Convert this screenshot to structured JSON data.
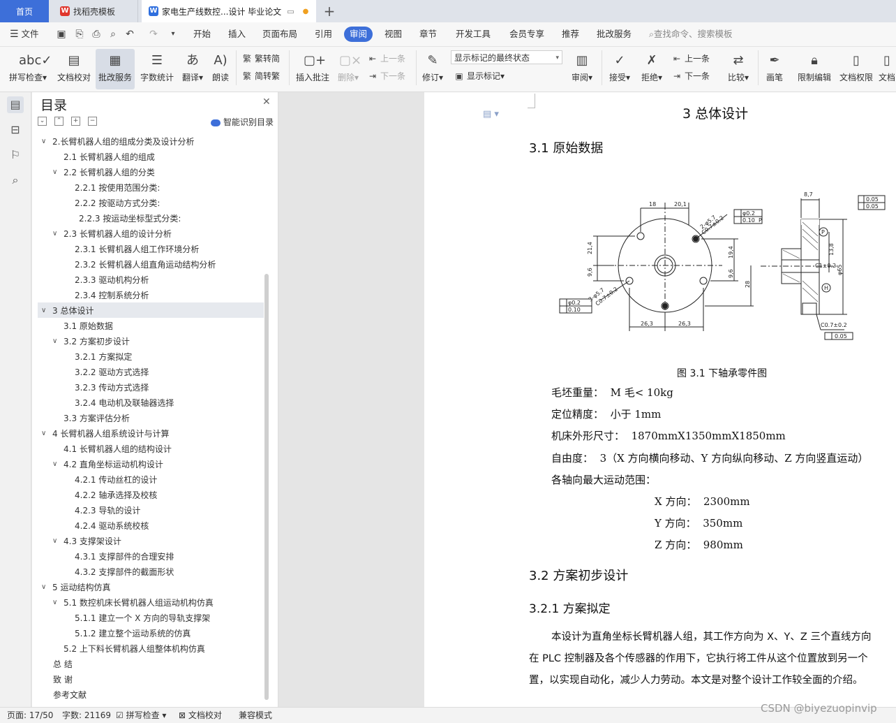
{
  "tabs": {
    "home": "首页",
    "template": "找稻壳模板",
    "document": "家电生产线数控...设计 毕业论文",
    "template_icon": "wps-docer-icon",
    "document_icon": "wps-writer-icon",
    "add": "+"
  },
  "menu": {
    "file": "文件",
    "items": [
      "开始",
      "插入",
      "页面布局",
      "引用",
      "审阅",
      "视图",
      "章节",
      "开发工具",
      "会员专享",
      "推荐",
      "批改服务"
    ],
    "search_placeholder": "查找命令、搜索模板"
  },
  "ribbon": {
    "spellcheck": "拼写检查",
    "doc_check": "文档校对",
    "revise_service": "批改服务",
    "word_count": "字数统计",
    "translate": "翻译",
    "read_aloud": "朗读",
    "trad_to_simp": "繁转简",
    "simp_to_trad": "简转繁",
    "insert_comment": "插入批注",
    "delete": "删除",
    "prev": "上一条",
    "next": "下一条",
    "track_changes": "修订",
    "markup_state": "显示标记的最终状态",
    "show_markup": "显示标记",
    "review_pane": "审阅",
    "accept": "接受",
    "reject": "拒绝",
    "prev2": "上一条",
    "next2": "下一条",
    "compare": "比较",
    "pen": "画笔",
    "restrict_edit": "限制编辑",
    "doc_permission": "文档权限",
    "doc_more": "文档"
  },
  "toc": {
    "title": "目录",
    "smart": "智能识别目录",
    "items": [
      {
        "text": "2.长臂机器人组的组成分类及设计分析",
        "level": 1,
        "arrow": true
      },
      {
        "text": "2.1  长臂机器人组的组成",
        "level": 2,
        "arrow": false
      },
      {
        "text": "2.2  长臂机器人组的分类",
        "level": 2,
        "arrow": true
      },
      {
        "text": "2.2.1  按使用范围分类:",
        "level": 3,
        "arrow": false
      },
      {
        "text": "2.2.2 按驱动方式分类:",
        "level": 3,
        "arrow": false
      },
      {
        "text": "2.2.3 按运动坐标型式分类:",
        "level": 4,
        "arrow": false
      },
      {
        "text": "2.3  长臂机器人组的设计分析",
        "level": 2,
        "arrow": true
      },
      {
        "text": "2.3.1 长臂机器人组工作环境分析",
        "level": 3,
        "arrow": false
      },
      {
        "text": "2.3.2 长臂机器人组直角运动结构分析",
        "level": 3,
        "arrow": false
      },
      {
        "text": "2.3.3 驱动机构分析",
        "level": 3,
        "arrow": false
      },
      {
        "text": "2.3.4 控制系统分析",
        "level": 3,
        "arrow": false
      },
      {
        "text": "3  总体设计",
        "level": 1,
        "arrow": true
      },
      {
        "text": "3.1  原始数据",
        "level": 2,
        "arrow": false
      },
      {
        "text": "3.2  方案初步设计",
        "level": 2,
        "arrow": true
      },
      {
        "text": "3.2.1  方案拟定",
        "level": 3,
        "arrow": false
      },
      {
        "text": "3.2.2  驱动方式选择",
        "level": 3,
        "arrow": false
      },
      {
        "text": "3.2.3  传动方式选择",
        "level": 3,
        "arrow": false
      },
      {
        "text": "3.2.4  电动机及联轴器选择",
        "level": 3,
        "arrow": false
      },
      {
        "text": "3.3  方案评估分析",
        "level": 2,
        "arrow": false
      },
      {
        "text": "4  长臂机器人组系统设计与计算",
        "level": 1,
        "arrow": true
      },
      {
        "text": "4.1 长臂机器人组的结构设计",
        "level": 2,
        "arrow": false
      },
      {
        "text": "4.2 直角坐标运动机构设计",
        "level": 2,
        "arrow": true
      },
      {
        "text": "4.2.1 传动丝杠的设计",
        "level": 3,
        "arrow": false
      },
      {
        "text": "4.2.2 轴承选择及校核",
        "level": 3,
        "arrow": false
      },
      {
        "text": "4.2.3 导轨的设计",
        "level": 3,
        "arrow": false
      },
      {
        "text": "4.2.4  驱动系统校核",
        "level": 3,
        "arrow": false
      },
      {
        "text": "4.3  支撑架设计",
        "level": 2,
        "arrow": true
      },
      {
        "text": "4.3.1 支撑部件的合理安排",
        "level": 3,
        "arrow": false
      },
      {
        "text": "4.3.2 支撑部件的截面形状",
        "level": 3,
        "arrow": false
      },
      {
        "text": "5  运动结构仿真",
        "level": 1,
        "arrow": true
      },
      {
        "text": "5.1 数控机床长臂机器人组运动机构仿真",
        "level": 2,
        "arrow": true
      },
      {
        "text": "5.1.1 建立一个 X 方向的导轨支撑架",
        "level": 3,
        "arrow": false
      },
      {
        "text": "5.1.2 建立整个运动系统的仿真",
        "level": 3,
        "arrow": false
      },
      {
        "text": "5.2 上下料长臂机器人组整体机构仿真",
        "level": 2,
        "arrow": false
      },
      {
        "text": "总  结",
        "level": 0,
        "arrow": false
      },
      {
        "text": "致  谢",
        "level": 0,
        "arrow": false
      },
      {
        "text": "参考文献",
        "level": 0,
        "arrow": false
      }
    ]
  },
  "document": {
    "chapter_title": "3  总体设计",
    "section_title": "3.1  原始数据",
    "figure_caption": "图 3.1  下轴承零件图",
    "drawing_labels": {
      "d18": "18",
      "d20_1": "20,1",
      "d21_4": "21,4",
      "d9_6": "9,6",
      "d19_4": "19,4",
      "d9_6b": "9,6",
      "d28": "28",
      "d26_3a": "26,3",
      "d26_3b": "26,3",
      "hole_top": "2-φ5.7",
      "hole_bottom": "3-φ5.7",
      "ch_top": "C0.7±0.2",
      "ch_bot": "C0.7±0.2",
      "tol_top1": "φ0.2",
      "tol_top2": "0.10",
      "datum_p": "P",
      "tol_bot1": "φ0.2",
      "tol_bot2": "0.10",
      "d8_7": "8,7",
      "tol_r1": "0.05",
      "tol_r2": "0.05",
      "datum_h": "H",
      "d13_8": "13,8",
      "d65": "φ65",
      "c1": "C1±0.2",
      "c07": "C0.7±0.2",
      "tol_r3": "0.05"
    },
    "params": [
      {
        "label": "毛坯重量：",
        "value": "M 毛< 10kg"
      },
      {
        "label": "定位精度：",
        "value": "小于 1mm"
      },
      {
        "label": "机床外形尺寸：",
        "value": "1870mmX1350mmX1850mm"
      },
      {
        "label": "自由度：",
        "value": "3（X 方向横向移动、Y 方向纵向移动、Z 方向竖直运动）"
      }
    ],
    "axis_range_intro": "各轴向最大运动范围：",
    "axis_ranges": [
      {
        "label": "X 方向：",
        "value": "2300mm"
      },
      {
        "label": "Y 方向：",
        "value": "350mm"
      },
      {
        "label": "Z 方向：",
        "value": "980mm"
      }
    ],
    "section2_title": "3.2  方案初步设计",
    "subsection_title": "3.2.1  方案拟定",
    "para_lines": [
      "本设计为直角坐标长臂机器人组，其工作方向为 X、Y、Z 三个直线方向",
      "在 PLC 控制器及各个传感器的作用下，它执行将工件从这个位置放到另一个",
      "置，以实现自动化，减少人力劳动。本文是对整个设计工作较全面的介绍。"
    ]
  },
  "status": {
    "page": "页面: 17/50",
    "words": "字数: 21169",
    "spell": "拼写检查",
    "proof": "文档校对",
    "compat": "兼容模式"
  },
  "watermark": "CSDN @biyezuopinvip",
  "colors": {
    "accent": "#3d6fd9",
    "toc_selected": "#e6e9ee"
  }
}
